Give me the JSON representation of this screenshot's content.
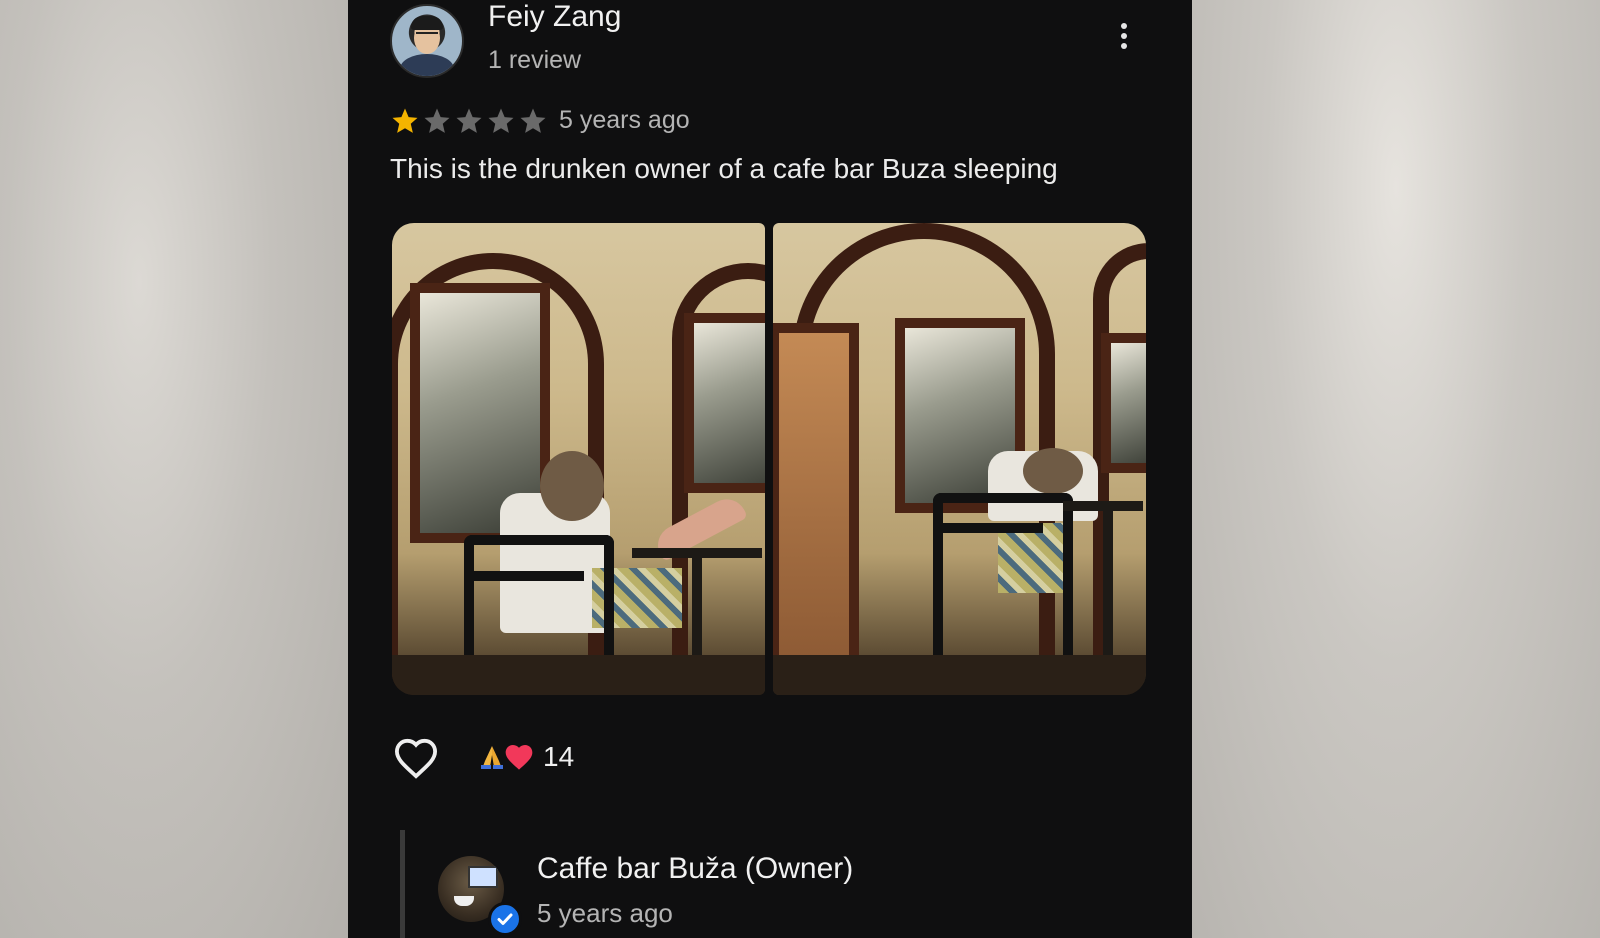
{
  "review": {
    "reviewer_name": "Feiy Zang",
    "review_count": "1 review",
    "rating": 1,
    "rating_max": 5,
    "time_ago": "5 years ago",
    "text": "This is the drunken owner of a cafe bar Buza sleeping"
  },
  "photos": [
    {
      "label": "photo-1"
    },
    {
      "label": "photo-2"
    }
  ],
  "reactions": {
    "count": "14",
    "icons": [
      "pray-icon",
      "heart-icon"
    ]
  },
  "owner_reply": {
    "name": "Caffe bar Buža (Owner)",
    "time_ago": "5 years ago"
  },
  "colors": {
    "star_filled": "#f4b400",
    "star_empty": "#6a6a6a",
    "panel_bg": "#0f0f10",
    "verified": "#1a73e8"
  }
}
